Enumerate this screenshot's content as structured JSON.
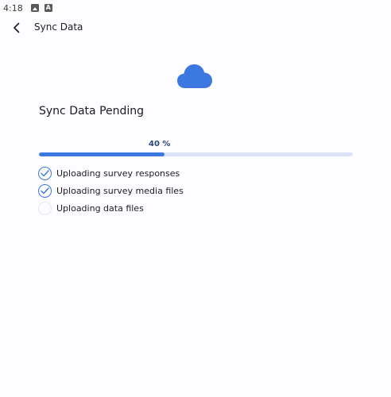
{
  "status_bar": {
    "time": "4:18",
    "icons": [
      "image-icon",
      "font-icon"
    ]
  },
  "app_bar": {
    "title": "Sync Data",
    "back_icon": "chevron-left-icon"
  },
  "cloud_icon": "cloud-icon",
  "heading": "Sync Data Pending",
  "progress": {
    "label": "40 %",
    "value": 0.4
  },
  "tasks": [
    {
      "label": "Uploading survey responses",
      "done": true
    },
    {
      "label": "Uploading survey media files",
      "done": true
    },
    {
      "label": "Uploading data files",
      "done": false
    }
  ],
  "colors": {
    "accent": "#3b78e0",
    "track": "#dbe4f7",
    "cloud": "#3b78e0",
    "background": "#fdfcff"
  }
}
